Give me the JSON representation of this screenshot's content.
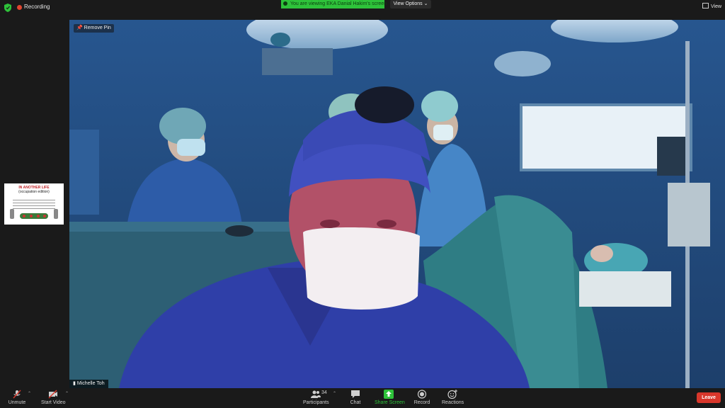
{
  "topbar": {
    "recording_label": "Recording",
    "viewing_banner": "You are viewing EKA Danial Hakim's screen",
    "view_options_label": "View Options",
    "view_label": "View"
  },
  "stage": {
    "remove_pin_label": "Remove Pin",
    "speaker_name": "Michelle Toh"
  },
  "thumbnail": {
    "title": "IN ANOTHER LIFE",
    "subtitle": "(occupation edition)"
  },
  "toolbar": {
    "unmute_label": "Unmute",
    "start_video_label": "Start Video",
    "participants_label": "Participants",
    "participants_count": "34",
    "chat_label": "Chat",
    "share_screen_label": "Share Screen",
    "record_label": "Record",
    "reactions_label": "Reactions",
    "leave_label": "Leave"
  },
  "colors": {
    "share_green": "#2ec23a",
    "leave_red": "#d8372b",
    "recording_red": "#e0452f"
  }
}
